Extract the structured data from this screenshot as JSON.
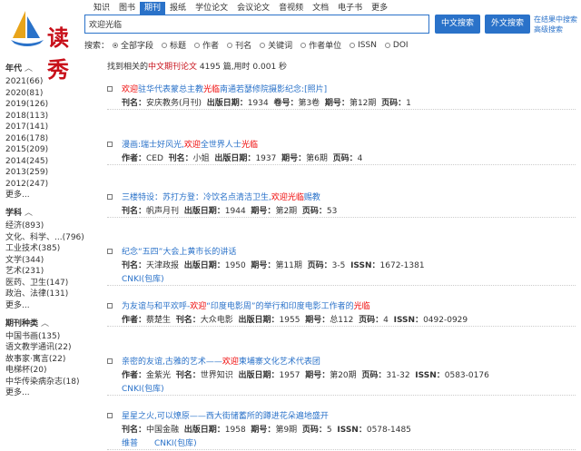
{
  "logo": {
    "text": "读秀"
  },
  "nav": {
    "tabs": [
      "知识",
      "图书",
      "期刊",
      "报纸",
      "学位论文",
      "会议论文",
      "音视频",
      "文档",
      "电子书",
      "更多"
    ],
    "active_index": 2
  },
  "search": {
    "value": "欢迎光临",
    "zh_button": "中文搜索",
    "foreign_button": "外文搜索",
    "link_within": "在结果中搜索",
    "link_advanced": "高级搜索"
  },
  "scope": {
    "label": "搜索：",
    "options": [
      "全部字段",
      "标题",
      "作者",
      "刊名",
      "关键词",
      "作者单位",
      "ISSN",
      "DOI"
    ],
    "selected_index": 0
  },
  "sidebar": {
    "year": {
      "title": "年代",
      "items": [
        "2021(66)",
        "2020(81)",
        "2019(126)",
        "2018(113)",
        "2017(141)",
        "2016(178)",
        "2015(209)",
        "2014(245)",
        "2013(259)",
        "2012(247)"
      ],
      "more": "更多..."
    },
    "subject": {
      "title": "学科",
      "items": [
        "经济(893)",
        "文化、科学、...(796)",
        "工业技术(385)",
        "文学(344)",
        "艺术(231)",
        "医药、卫生(147)",
        "政治、法律(131)"
      ],
      "more": "更多..."
    },
    "journal": {
      "title": "期刊种类",
      "items": [
        "中国书画(135)",
        "语文教学通讯(22)",
        "故事家·寓言(22)",
        "电梯杯(20)",
        "中华传染病杂志(18)"
      ],
      "more": "更多..."
    }
  },
  "results": {
    "summary_prefix": "找到相关的",
    "summary_type": "中文期刊论文",
    "summary_count": "4195",
    "summary_suffix": "篇,用时 0.001 秒",
    "items": [
      {
        "title": [
          {
            "t": "欢迎",
            "r": true
          },
          {
            "t": "驻华代表蒙总主教",
            "r": false
          },
          {
            "t": "光临",
            "r": true
          },
          {
            "t": "南通若瑟修院摄影纪念:[照片]",
            "r": false
          }
        ],
        "meta": [
          {
            "k": "刊名：",
            "v": "安庆教务(月刊)"
          },
          {
            "k": "出版日期：",
            "v": "1934"
          },
          {
            "k": "卷号：",
            "v": "第3卷"
          },
          {
            "k": "期号：",
            "v": "第12期"
          },
          {
            "k": "页码：",
            "v": "1"
          }
        ],
        "links": []
      },
      {
        "title": [
          {
            "t": "漫画:瑞士好风光,",
            "r": false
          },
          {
            "t": "欢迎",
            "r": true
          },
          {
            "t": "全世界人士",
            "r": false
          },
          {
            "t": "光临",
            "r": true
          }
        ],
        "meta": [
          {
            "k": "作者：",
            "v": "CED"
          },
          {
            "k": "刊名：",
            "v": "小姐"
          },
          {
            "k": "出版日期：",
            "v": "1937"
          },
          {
            "k": "期号：",
            "v": "第6期"
          },
          {
            "k": "页码：",
            "v": "4"
          }
        ],
        "links": []
      },
      {
        "title": [
          {
            "t": "三楼特设：苏打方登：冷饮名点清洁卫生,",
            "r": false
          },
          {
            "t": "欢迎光临",
            "r": true
          },
          {
            "t": "赐教",
            "r": false
          }
        ],
        "meta": [
          {
            "k": "刊名：",
            "v": "帆声月刊"
          },
          {
            "k": "出版日期：",
            "v": "1944"
          },
          {
            "k": "期号：",
            "v": "第2期"
          },
          {
            "k": "页码：",
            "v": "53"
          }
        ],
        "links": []
      },
      {
        "title": [
          {
            "t": "纪念“五四”大会上黄市长的讲话",
            "r": false
          }
        ],
        "meta": [
          {
            "k": "刊名：",
            "v": "天津政报"
          },
          {
            "k": "出版日期：",
            "v": "1950"
          },
          {
            "k": "期号：",
            "v": "第11期"
          },
          {
            "k": "页码：",
            "v": "3-5"
          },
          {
            "k": "ISSN：",
            "v": "1672-1381"
          }
        ],
        "links": [
          "CNKI(包库)"
        ]
      },
      {
        "title": [
          {
            "t": "为友谊与和平欢呼-",
            "r": false
          },
          {
            "t": "欢迎",
            "r": true
          },
          {
            "t": "“印度电影周”的举行和印度电影工作者的",
            "r": false
          },
          {
            "t": "光临",
            "r": true
          }
        ],
        "meta": [
          {
            "k": "作者：",
            "v": "蔡楚生"
          },
          {
            "k": "刊名：",
            "v": "大众电影"
          },
          {
            "k": "出版日期：",
            "v": "1955"
          },
          {
            "k": "期号：",
            "v": "总112"
          },
          {
            "k": "页码：",
            "v": "4"
          },
          {
            "k": "ISSN：",
            "v": "0492-0929"
          }
        ],
        "links": []
      },
      {
        "title": [
          {
            "t": "亲密的友谊,古雅的艺术——",
            "r": false
          },
          {
            "t": "欢迎",
            "r": true
          },
          {
            "t": "柬埔寨文化艺术代表团",
            "r": false
          }
        ],
        "meta": [
          {
            "k": "作者：",
            "v": "金紫光"
          },
          {
            "k": "刊名：",
            "v": "世界知识"
          },
          {
            "k": "出版日期：",
            "v": "1957"
          },
          {
            "k": "期号：",
            "v": "第20期"
          },
          {
            "k": "页码：",
            "v": "31-32"
          },
          {
            "k": "ISSN：",
            "v": "0583-0176"
          }
        ],
        "links": [
          "CNKI(包库)"
        ]
      },
      {
        "title": [
          {
            "t": "星星之火,可以燎原——西大街储蓄所的蹲进花朵遍地盛开",
            "r": false
          }
        ],
        "meta": [
          {
            "k": "刊名：",
            "v": "中国金融"
          },
          {
            "k": "出版日期：",
            "v": "1958"
          },
          {
            "k": "期号：",
            "v": "第9期"
          },
          {
            "k": "页码：",
            "v": "5"
          },
          {
            "k": "ISSN：",
            "v": "0578-1485"
          }
        ],
        "links": [
          "维普",
          "CNKI(包库)"
        ]
      }
    ]
  }
}
